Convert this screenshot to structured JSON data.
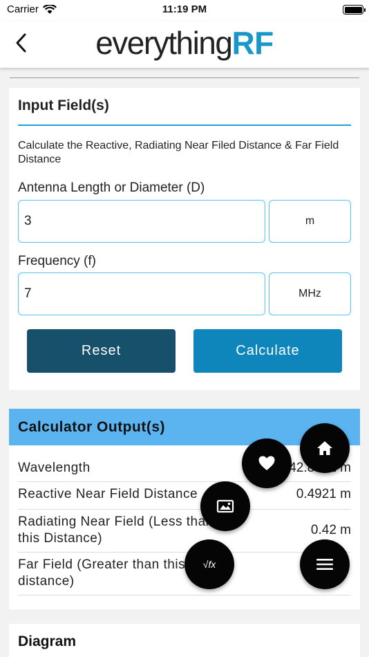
{
  "status_bar": {
    "carrier": "Carrier",
    "time": "11:19 PM"
  },
  "nav": {
    "logo_part1": "everything",
    "logo_part2": "RF"
  },
  "input_card": {
    "title": "Input Field(s)",
    "description": "Calculate the Reactive, Radiating Near Filed Distance & Far Field Distance",
    "field1": {
      "label": "Antenna Length or Diameter (D)",
      "value": "3",
      "unit": "m"
    },
    "field2": {
      "label": "Frequency (f)",
      "value": "7",
      "unit": "MHz"
    },
    "reset_label": "Reset",
    "calculate_label": "Calculate"
  },
  "output_card": {
    "title": "Calculator Output(s)",
    "rows": [
      {
        "label": "Wavelength",
        "value": "42.8571 m"
      },
      {
        "label": "Reactive Near Field Distance",
        "value": "0.4921 m"
      },
      {
        "label": "Radiating Near Field (Less than this Distance)",
        "value": "0.42 m"
      },
      {
        "label": "Far Field (Greater than this distance)",
        "value": ""
      }
    ]
  },
  "diagram_card": {
    "title": "Diagram"
  },
  "fabs": {
    "home": "home-icon",
    "favorite": "heart-icon",
    "image": "image-icon",
    "formula": "formula-icon",
    "menu": "menu-icon",
    "formula_glyph": "√fx"
  },
  "colors": {
    "accent": "#1aa3d6",
    "reset": "#17506b",
    "calculate": "#0e85bb",
    "output_header": "#5bb4f0"
  }
}
